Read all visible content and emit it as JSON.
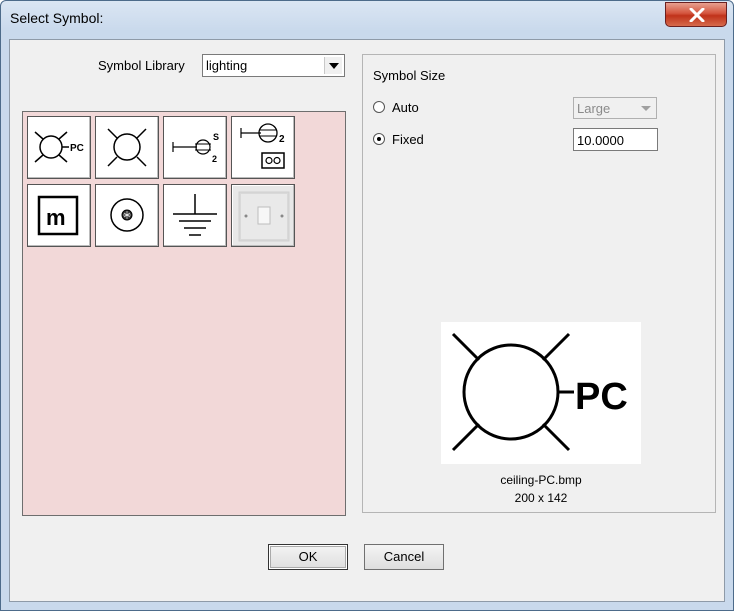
{
  "window": {
    "title": "Select Symbol:"
  },
  "library": {
    "label": "Symbol Library",
    "selected": "lighting"
  },
  "symbols": [
    {
      "name": "ceiling-PC",
      "icon": "ceiling-pc-icon",
      "label": "PC"
    },
    {
      "name": "ceiling",
      "icon": "ceiling-light-icon"
    },
    {
      "name": "switch-s2",
      "icon": "switch-s2-icon",
      "label_top": "S",
      "label_bottom": "2"
    },
    {
      "name": "switch-socket",
      "icon": "switch-socket-icon",
      "label": "2"
    },
    {
      "name": "m-box",
      "icon": "m-box-icon",
      "label": "m"
    },
    {
      "name": "spot",
      "icon": "spot-light-icon"
    },
    {
      "name": "earth",
      "icon": "earth-ground-icon"
    },
    {
      "name": "wall-switch",
      "icon": "wall-switch-icon"
    }
  ],
  "size": {
    "title": "Symbol Size",
    "auto_label": "Auto",
    "fixed_label": "Fixed",
    "mode": "Fixed",
    "auto_value": "Large",
    "fixed_value": "10.0000"
  },
  "preview": {
    "label": "PC",
    "filename": "ceiling-PC.bmp",
    "dimensions": "200 x 142"
  },
  "buttons": {
    "ok": "OK",
    "cancel": "Cancel"
  }
}
